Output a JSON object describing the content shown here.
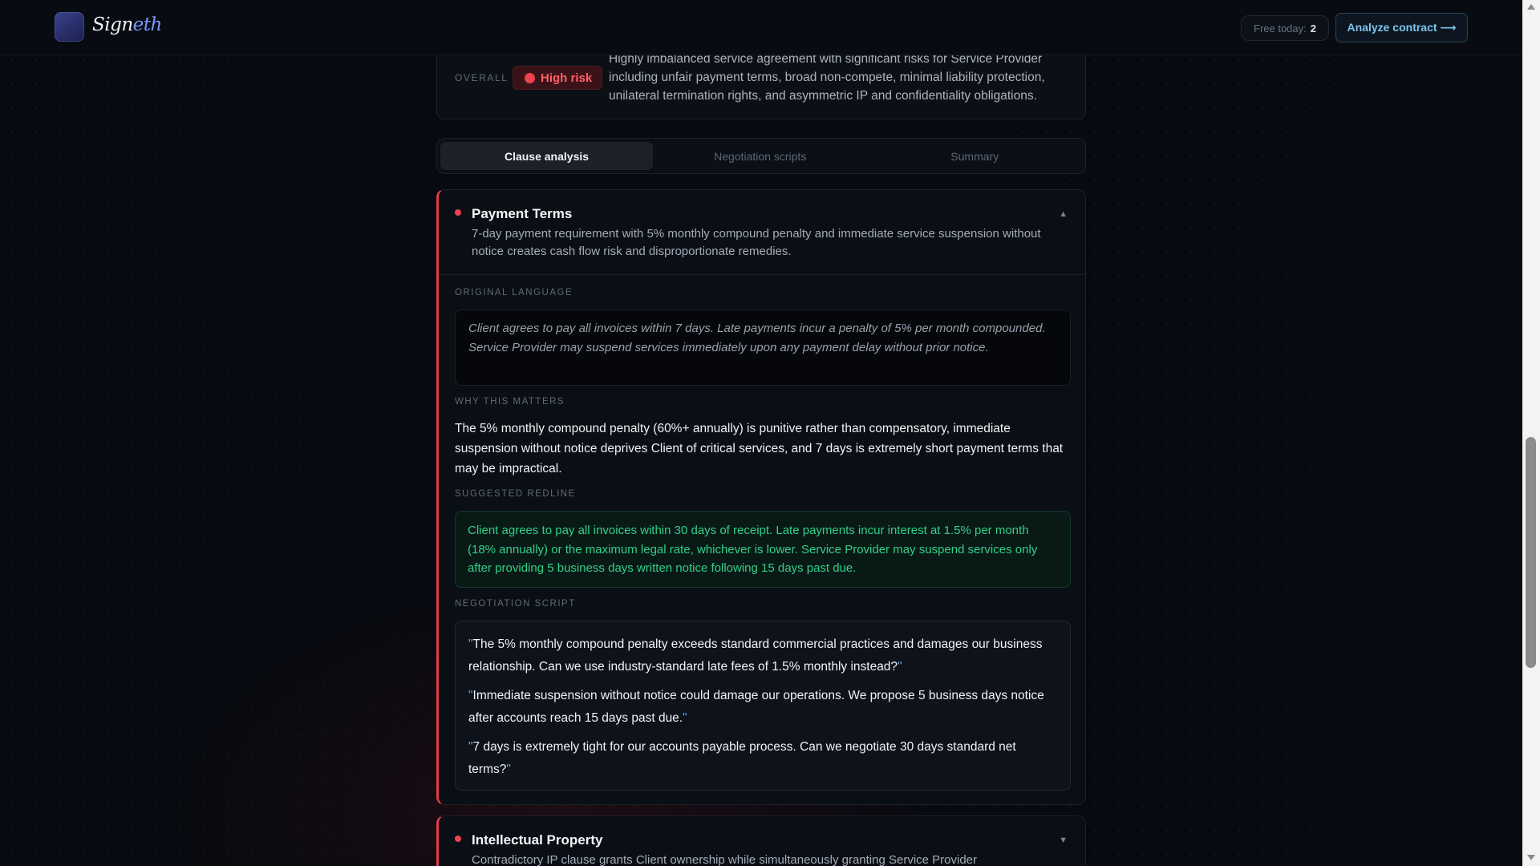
{
  "header": {
    "brand_main": "Sign",
    "brand_accent": "eth",
    "free_label": "Free today:",
    "free_count": "2",
    "analyze_label": "Analyze contract ⟶"
  },
  "overall": {
    "label": "OVERALL",
    "risk_label": "High risk",
    "summary": "Highly imbalanced service agreement with significant risks for Service Provider including unfair payment terms, broad non-compete, minimal liability protection, unilateral termination rights, and asymmetric IP and confidentiality obligations."
  },
  "tabs": [
    {
      "label": "Clause analysis",
      "active": true
    },
    {
      "label": "Negotiation scripts",
      "active": false
    },
    {
      "label": "Summary",
      "active": false
    }
  ],
  "clauses": [
    {
      "title": "Payment Terms",
      "summary": "7-day payment requirement with 5% monthly compound penalty and immediate service suspension without notice creates cash flow risk and disproportionate remedies.",
      "chevron": "▲",
      "original_label": "ORIGINAL LANGUAGE",
      "original": "Client agrees to pay all invoices within 7 days. Late payments incur a penalty of 5% per month compounded. Service Provider may suspend services immediately upon any payment delay without prior notice.",
      "why_label": "WHY THIS MATTERS",
      "why": "The 5% monthly compound penalty (60%+ annually) is punitive rather than compensatory, immediate suspension without notice deprives Client of critical services, and 7 days is extremely short payment terms that may be impractical.",
      "redline_label": "SUGGESTED REDLINE",
      "redline": "Client agrees to pay all invoices within 30 days of receipt. Late payments incur interest at 1.5% per month (18% annually) or the maximum legal rate, whichever is lower. Service Provider may suspend services only after providing 5 business days written notice following 15 days past due.",
      "script_label": "NEGOTIATION SCRIPT",
      "quote_mark": "\"",
      "scripts": [
        "The 5% monthly compound penalty exceeds standard commercial practices and damages our business relationship. Can we use industry-standard late fees of 1.5% monthly instead?",
        "Immediate suspension without notice could damage our operations. We propose 5 business days notice after accounts reach 15 days past due.",
        "7 days is extremely tight for our accounts payable process. Can we negotiate 30 days standard net terms?"
      ]
    },
    {
      "title": "Intellectual Property",
      "summary": "Contradictory IP clause grants Client ownership while simultaneously granting Service Provider",
      "chevron": "▼"
    }
  ],
  "colors": {
    "accent_blue": "#7fc4ee",
    "risk_red": "#f0414e",
    "redline_green": "#33cf8a"
  }
}
